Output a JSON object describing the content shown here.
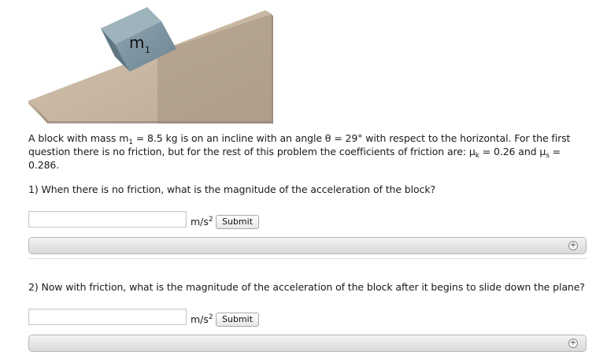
{
  "figure": {
    "block_label": "m",
    "block_label_sub": "1"
  },
  "problem": {
    "t1": "A block with mass m",
    "t1_sub": "1",
    "t2": " = 8.5 kg is on an incline with an angle θ = 29° with respect to the horizontal. For the first question there is no friction, but for the rest of this problem the coefficients of friction are: μ",
    "t2_sub": "k",
    "t3": " = 0.26 and μ",
    "t3_sub": "s",
    "t4": " = 0.286."
  },
  "questions": [
    {
      "text": "1) When there is no friction, what is the magnitude of the acceleration of the block?",
      "answer_value": "",
      "unit": "m/s",
      "unit_sup": "2",
      "submit_label": "Submit",
      "hint_icon": "plus-circle-icon"
    },
    {
      "text": "2) Now with friction, what is the magnitude of the acceleration of the block after it begins to slide down the plane?",
      "answer_value": "",
      "unit": "m/s",
      "unit_sup": "2",
      "submit_label": "Submit",
      "hint_icon": "plus-circle-icon"
    }
  ],
  "colors": {
    "incline_top": "#c9b9a4",
    "incline_side": "#a59684",
    "block_top": "#8fa3ae",
    "block_front": "#6f8794"
  }
}
